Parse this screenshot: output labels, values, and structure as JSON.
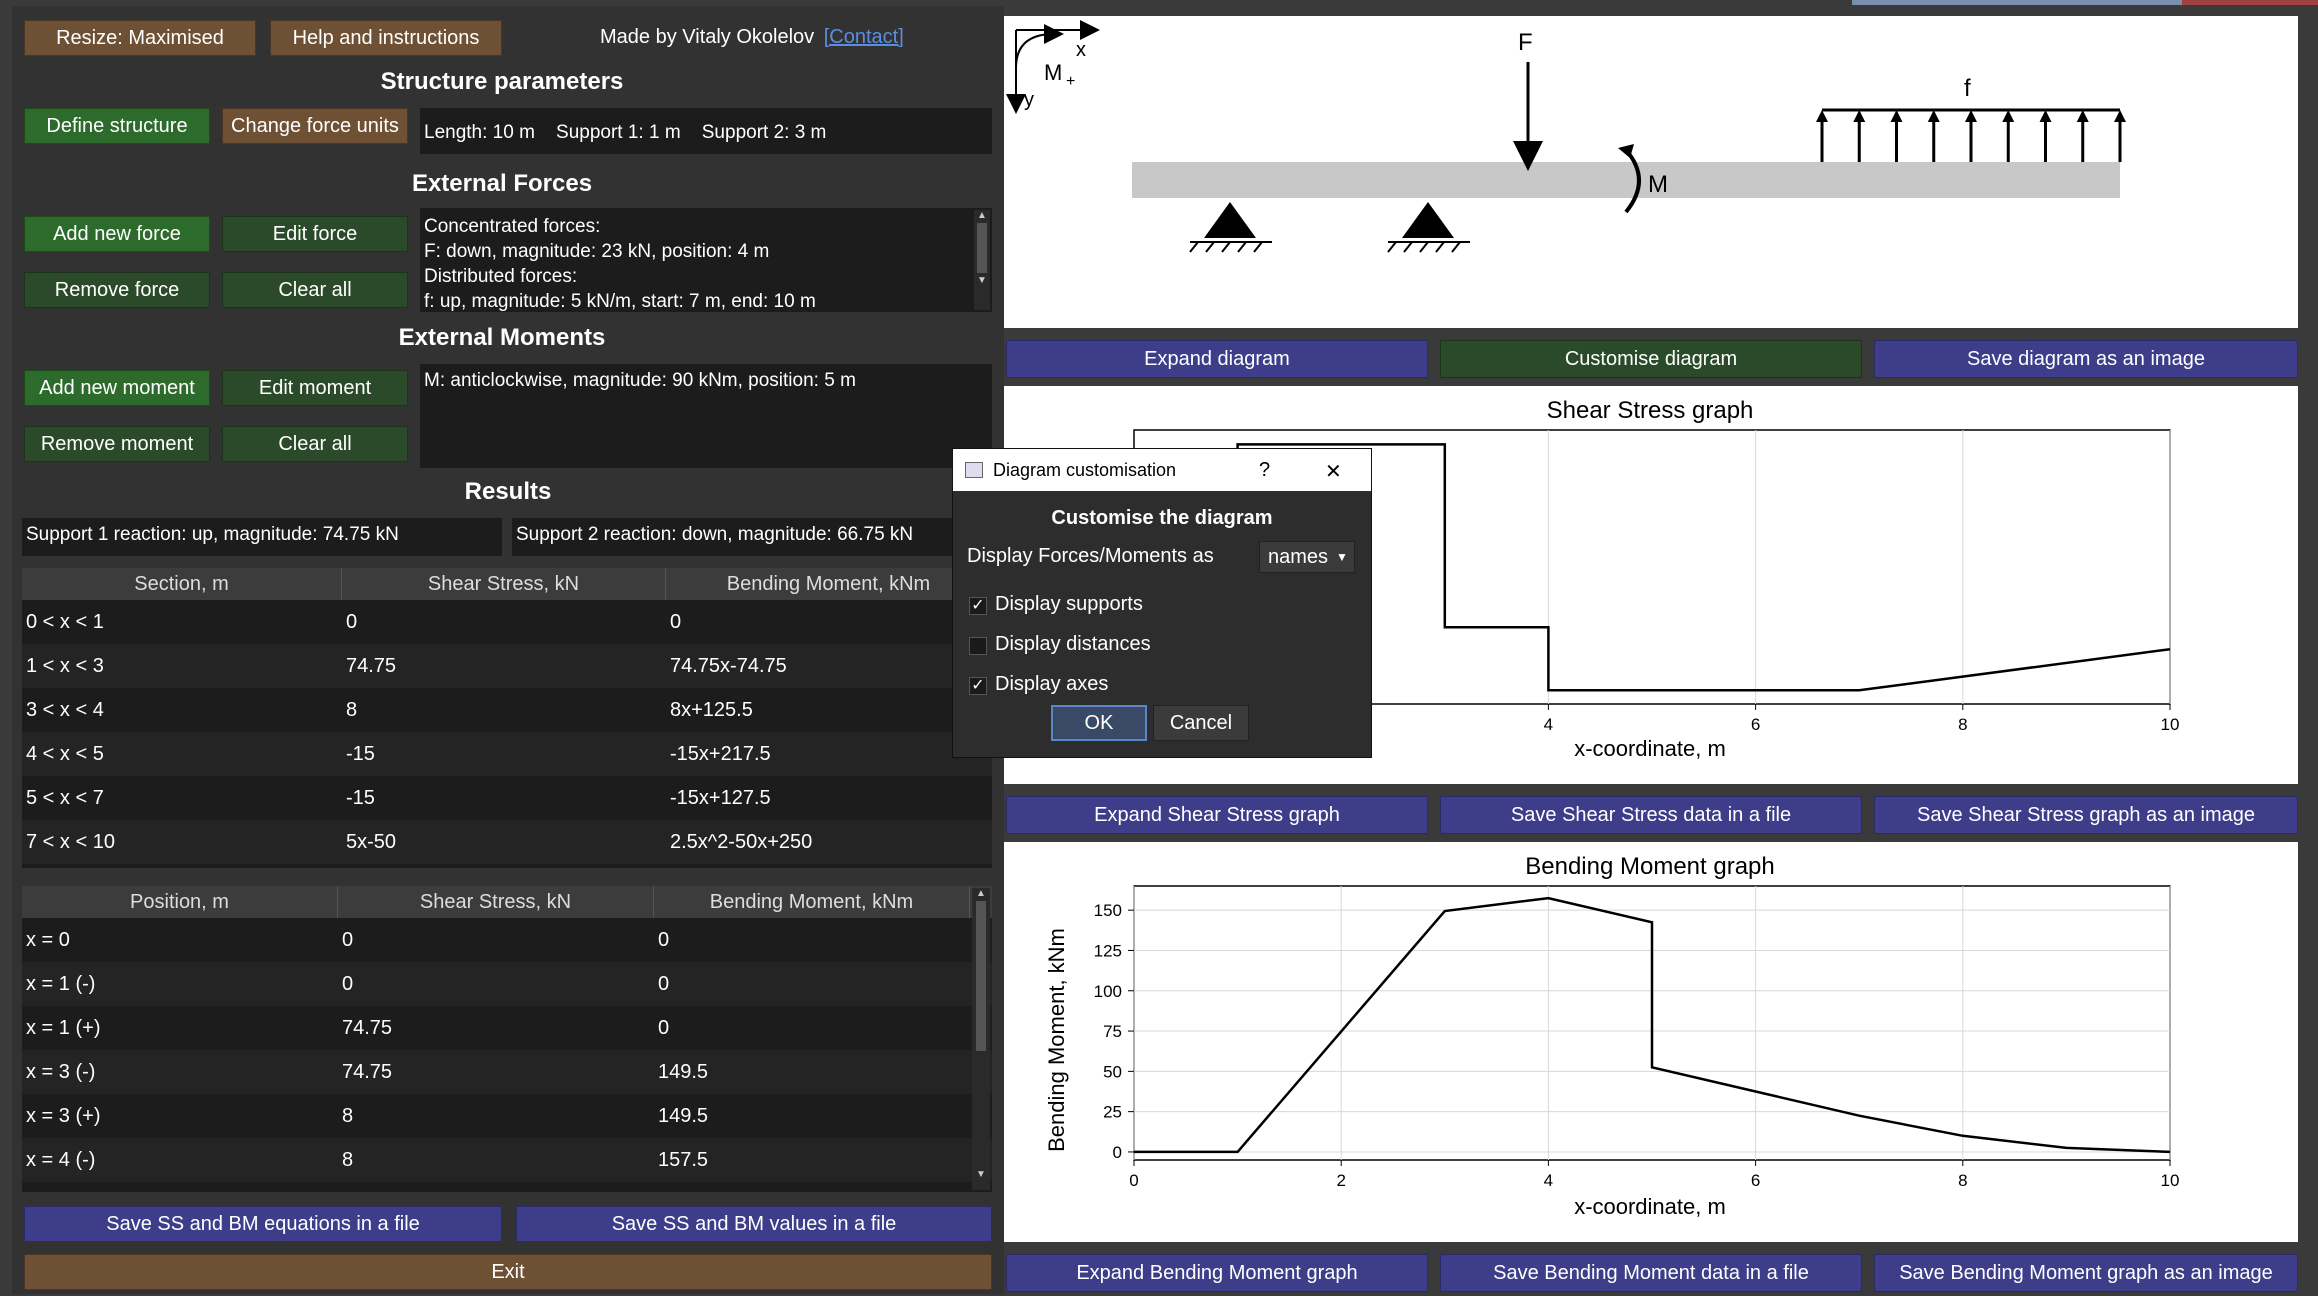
{
  "top": {
    "resize_label": "Resize: Maximised",
    "help_label": "Help and instructions",
    "credit": "Made by Vitaly Okolelov",
    "contact": "[Contact]"
  },
  "structure": {
    "title": "Structure parameters",
    "define_label": "Define structure",
    "units_label": "Change force units",
    "info": "Length: 10 m    Support 1: 1 m    Support 2: 3 m"
  },
  "forces": {
    "title": "External Forces",
    "add_label": "Add new force",
    "edit_label": "Edit force",
    "remove_label": "Remove force",
    "clear_label": "Clear all",
    "lines": [
      "Concentrated forces:",
      "F: down, magnitude: 23 kN, position: 4 m",
      "Distributed forces:",
      "f: up, magnitude: 5 kN/m, start: 7 m, end: 10 m"
    ]
  },
  "moments": {
    "title": "External Moments",
    "add_label": "Add new moment",
    "edit_label": "Edit moment",
    "remove_label": "Remove moment",
    "clear_label": "Clear all",
    "line": "M: anticlockwise, magnitude: 90 kNm, position: 5 m"
  },
  "results": {
    "title": "Results",
    "support1": "Support 1 reaction: up, magnitude: 74.75 kN",
    "support2": "Support 2 reaction: down, magnitude: 66.75 kN",
    "sections_headers": [
      "Section, m",
      "Shear Stress, kN",
      "Bending Moment, kNm"
    ],
    "sections": [
      [
        "0 < x < 1",
        "0",
        "0"
      ],
      [
        "1 < x < 3",
        "74.75",
        "74.75x-74.75"
      ],
      [
        "3 < x < 4",
        "8",
        "8x+125.5"
      ],
      [
        "4 < x < 5",
        "-15",
        "-15x+217.5"
      ],
      [
        "5 < x < 7",
        "-15",
        "-15x+127.5"
      ],
      [
        "7 < x < 10",
        "5x-50",
        "2.5x^2-50x+250"
      ]
    ],
    "positions_headers": [
      "Position, m",
      "Shear Stress, kN",
      "Bending Moment, kNm"
    ],
    "positions": [
      [
        "x = 0",
        "0",
        "0"
      ],
      [
        "x = 1 (-)",
        "0",
        "0"
      ],
      [
        "x = 1 (+)",
        "74.75",
        "0"
      ],
      [
        "x = 3 (-)",
        "74.75",
        "149.5"
      ],
      [
        "x = 3 (+)",
        "8",
        "149.5"
      ],
      [
        "x = 4 (-)",
        "8",
        "157.5"
      ]
    ],
    "save_eq_label": "Save SS and BM equations in a file",
    "save_val_label": "Save SS and BM values in a file",
    "exit_label": "Exit"
  },
  "diagram": {
    "axis_x": "x",
    "axis_y": "y",
    "moment_positive": "M",
    "moment_positive_sub": "+",
    "force_label": "F",
    "moment_label": "M",
    "dist_label": "f",
    "expand_label": "Expand diagram",
    "customise_label": "Customise diagram",
    "save_label": "Save diagram as an image"
  },
  "shear": {
    "title": "Shear Stress graph",
    "xlabel": "x-coordinate, m",
    "expand_label": "Expand Shear Stress graph",
    "save_data_label": "Save Shear Stress data in a file",
    "save_img_label": "Save Shear Stress graph as an image"
  },
  "bending": {
    "title": "Bending Moment graph",
    "xlabel": "x-coordinate, m",
    "ylabel": "Bending Moment, kNm",
    "expand_label": "Expand Bending Moment graph",
    "save_data_label": "Save Bending Moment data in a file",
    "save_img_label": "Save Bending Moment graph as an image"
  },
  "dialog": {
    "title": "Diagram customisation",
    "help": "?",
    "close": "✕",
    "heading": "Customise the diagram",
    "display_as_label": "Display Forces/Moments as",
    "display_as_value": "names",
    "opt_supports": "Display supports",
    "opt_distances": "Display distances",
    "opt_axes": "Display axes",
    "check_supports": "✓",
    "check_axes": "✓",
    "ok_label": "OK",
    "cancel_label": "Cancel"
  },
  "chart_data": [
    {
      "type": "line",
      "title": "Shear Stress graph",
      "xlabel": "x-coordinate, m",
      "ylabel": "",
      "xlim": [
        0,
        10
      ],
      "ylim": [
        -20,
        80
      ],
      "x_ticks": [
        4,
        6,
        8,
        10
      ],
      "grid": true,
      "x": [
        0,
        1,
        1,
        3,
        3,
        4,
        4,
        7,
        10
      ],
      "y": [
        0,
        0,
        74.75,
        74.75,
        8,
        8,
        -15,
        -15,
        0
      ]
    },
    {
      "type": "line",
      "title": "Bending Moment graph",
      "xlabel": "x-coordinate, m",
      "ylabel": "Bending Moment, kNm",
      "xlim": [
        0,
        10
      ],
      "ylim": [
        -5,
        165
      ],
      "x_ticks": [
        0,
        2,
        4,
        6,
        8,
        10
      ],
      "y_ticks": [
        0,
        25,
        50,
        75,
        100,
        125,
        150
      ],
      "grid": true,
      "x": [
        0,
        1,
        3,
        4,
        5,
        5,
        6,
        7,
        8,
        9,
        10
      ],
      "y": [
        0,
        0,
        149.5,
        157.5,
        142.5,
        52.5,
        37.5,
        22.5,
        10,
        2.5,
        0
      ]
    }
  ]
}
